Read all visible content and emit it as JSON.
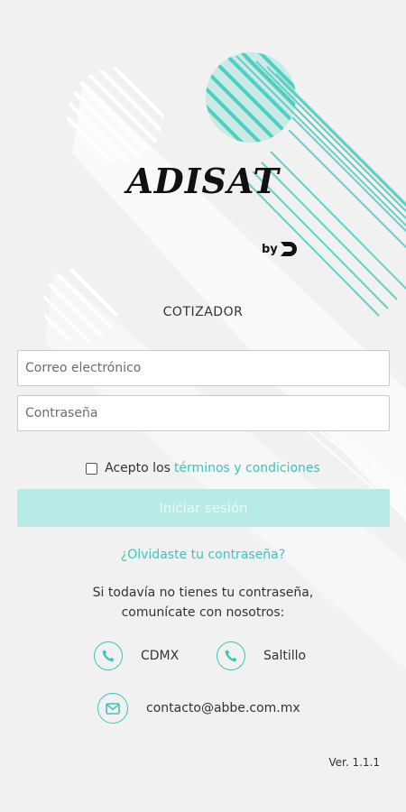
{
  "brand": {
    "name": "ADISAT",
    "by": "by",
    "accent_color": "#3fc4b8"
  },
  "subtitle": "COTIZADOR",
  "form": {
    "email_placeholder": "Correo electrónico",
    "password_placeholder": "Contraseña",
    "terms_prefix": "Acepto los",
    "terms_link": "términos y condiciones",
    "terms_checked": false,
    "login_label": "Iniciar sesión"
  },
  "forgot_password": "¿Olvidaste tu contraseña?",
  "info": {
    "line1": "Si todavía no tienes tu contraseña,",
    "line2": "comunícate con nosotros:"
  },
  "contacts": {
    "cdmx": "CDMX",
    "saltillo": "Saltillo",
    "email": "contacto@abbe.com.mx"
  },
  "version": "Ver. 1.1.1"
}
